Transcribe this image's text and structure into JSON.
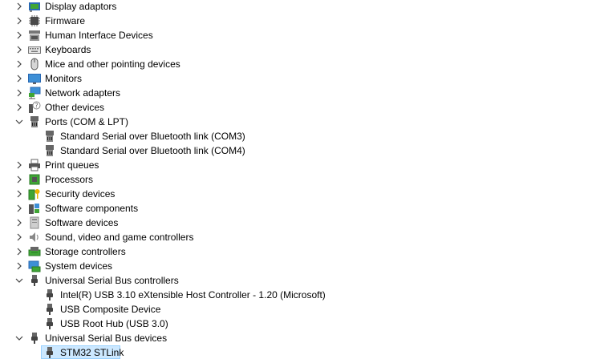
{
  "tree": {
    "items": [
      {
        "label": "Display adaptors"
      },
      {
        "label": "Firmware"
      },
      {
        "label": "Human Interface Devices"
      },
      {
        "label": "Keyboards"
      },
      {
        "label": "Mice and other pointing devices"
      },
      {
        "label": "Monitors"
      },
      {
        "label": "Network adapters"
      },
      {
        "label": "Other devices"
      },
      {
        "label": "Ports (COM & LPT)"
      },
      {
        "label": "Standard Serial over Bluetooth link (COM3)"
      },
      {
        "label": "Standard Serial over Bluetooth link (COM4)"
      },
      {
        "label": "Print queues"
      },
      {
        "label": "Processors"
      },
      {
        "label": "Security devices"
      },
      {
        "label": "Software components"
      },
      {
        "label": "Software devices"
      },
      {
        "label": "Sound, video and game controllers"
      },
      {
        "label": "Storage controllers"
      },
      {
        "label": "System devices"
      },
      {
        "label": "Universal Serial Bus controllers"
      },
      {
        "label": "Intel(R) USB 3.10 eXtensible Host Controller - 1.20 (Microsoft)"
      },
      {
        "label": "USB Composite Device"
      },
      {
        "label": "USB Root Hub (USB 3.0)"
      },
      {
        "label": "Universal Serial Bus devices"
      },
      {
        "label": "STM32 STLink"
      }
    ]
  },
  "colors": {
    "selection_fill": "#cce8ff",
    "selection_border": "#99d1ff",
    "chevron": "#404040"
  }
}
